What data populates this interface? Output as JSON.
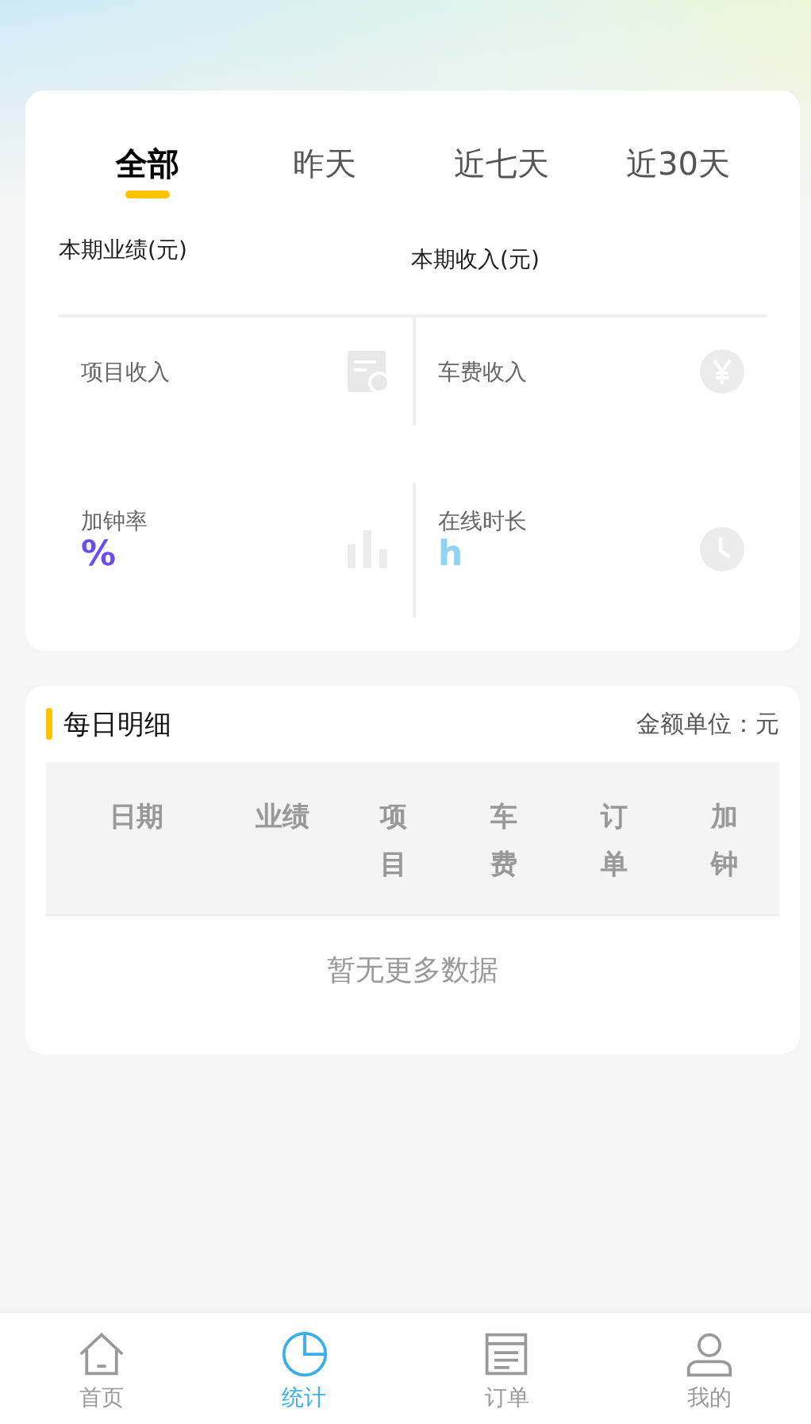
{
  "tabs": [
    {
      "label": "全部",
      "selected": true
    },
    {
      "label": "昨天",
      "selected": false
    },
    {
      "label": "近七天",
      "selected": false
    },
    {
      "label": "近30天",
      "selected": false
    }
  ],
  "summary": [
    {
      "label": "本期业绩(元)"
    },
    {
      "label": "本期收入(元)"
    }
  ],
  "stats": [
    {
      "label": "项目收入",
      "kind": "document"
    },
    {
      "label": "车费收入",
      "kind": "yen"
    },
    {
      "label": "加钟率",
      "value": "%",
      "color": "#6a4cf5",
      "kind": "bars"
    },
    {
      "label": "在线时长",
      "value": "h",
      "color": "#8fd3f7",
      "kind": "clock"
    }
  ],
  "daily": {
    "title": "每日明细",
    "unit": "金额单位：元",
    "columns": [
      "日期",
      "业绩",
      "项目",
      "车费",
      "订单",
      "加钟"
    ],
    "empty": "暂无更多数据"
  },
  "tabbar": [
    {
      "label": "首页",
      "kind": "home",
      "selected": false
    },
    {
      "label": "统计",
      "kind": "chart",
      "selected": true
    },
    {
      "label": "订单",
      "kind": "list",
      "selected": false
    },
    {
      "label": "我的",
      "kind": "user",
      "selected": false
    }
  ]
}
